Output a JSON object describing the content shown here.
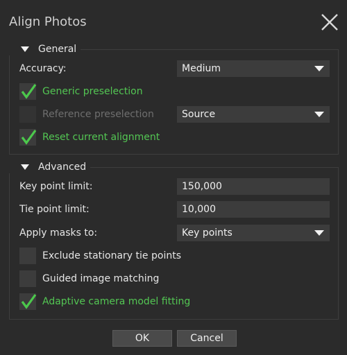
{
  "window": {
    "title": "Align Photos"
  },
  "general": {
    "header": "General",
    "accuracy_label": "Accuracy:",
    "accuracy_value": "Medium",
    "generic_preselection_label": "Generic preselection",
    "generic_preselection_checked": true,
    "reference_preselection_label": "Reference preselection",
    "reference_preselection_checked": false,
    "reference_source_value": "Source",
    "reset_alignment_label": "Reset current alignment",
    "reset_alignment_checked": true
  },
  "advanced": {
    "header": "Advanced",
    "key_point_limit_label": "Key point limit:",
    "key_point_limit_value": "150,000",
    "tie_point_limit_label": "Tie point limit:",
    "tie_point_limit_value": "10,000",
    "apply_masks_label": "Apply masks to:",
    "apply_masks_value": "Key points",
    "exclude_stationary_label": "Exclude stationary tie points",
    "exclude_stationary_checked": false,
    "guided_matching_label": "Guided image matching",
    "guided_matching_checked": false,
    "adaptive_fitting_label": "Adaptive camera model fitting",
    "adaptive_fitting_checked": true
  },
  "buttons": {
    "ok_label": "OK",
    "cancel_label": "Cancel"
  },
  "colors": {
    "background": "#2b2b2b",
    "checked_text": "#53c653",
    "checkmark": "#4cc94c",
    "disabled_text": "#6f6f6f",
    "control_bg": "#3c3c3c"
  },
  "icons": {
    "close": "close-icon",
    "collapse": "triangle-down-icon",
    "check": "checkmark-icon",
    "dropdown": "dropdown-arrow-icon"
  }
}
